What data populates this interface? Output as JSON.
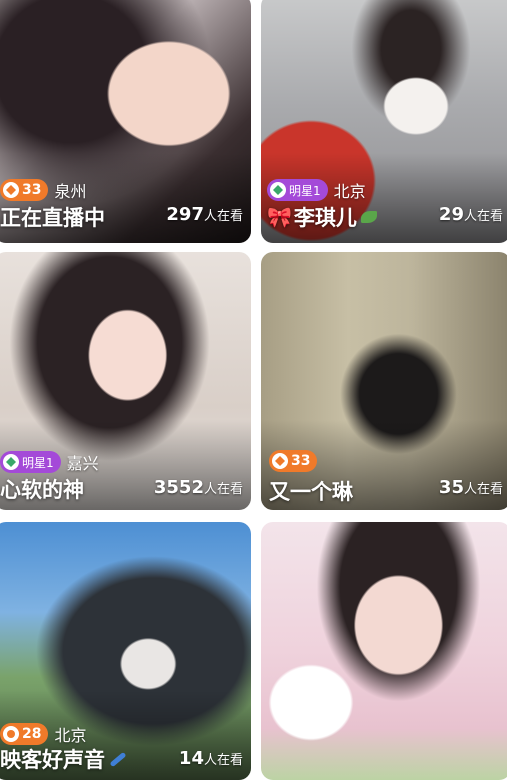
{
  "cards": [
    {
      "level": "33",
      "level_style": "orange",
      "city": "泉州",
      "title": "正在直播中",
      "viewer_count": "297",
      "viewer_suffix": "人在看"
    },
    {
      "level": "明星1",
      "level_style": "purple",
      "city": "北京",
      "title": "李琪儿",
      "viewer_count": "29",
      "viewer_suffix": "人在看"
    },
    {
      "level": "明星1",
      "level_style": "purple",
      "city": "嘉兴",
      "title": "心软的神",
      "viewer_count": "3552",
      "viewer_suffix": "人在看"
    },
    {
      "level": "33",
      "level_style": "orange",
      "city": "",
      "title": "又一个琳",
      "viewer_count": "35",
      "viewer_suffix": "人在看"
    },
    {
      "level": "28",
      "level_style": "orange",
      "city": "北京",
      "title": "映客好声音",
      "viewer_count": "14",
      "viewer_suffix": "人在看"
    },
    {
      "level": "",
      "level_style": "",
      "city": "",
      "title": "",
      "viewer_count": "",
      "viewer_suffix": ""
    }
  ],
  "colors": {
    "orange_badge": "#f07a2a",
    "purple_badge": "#a44ad8"
  }
}
